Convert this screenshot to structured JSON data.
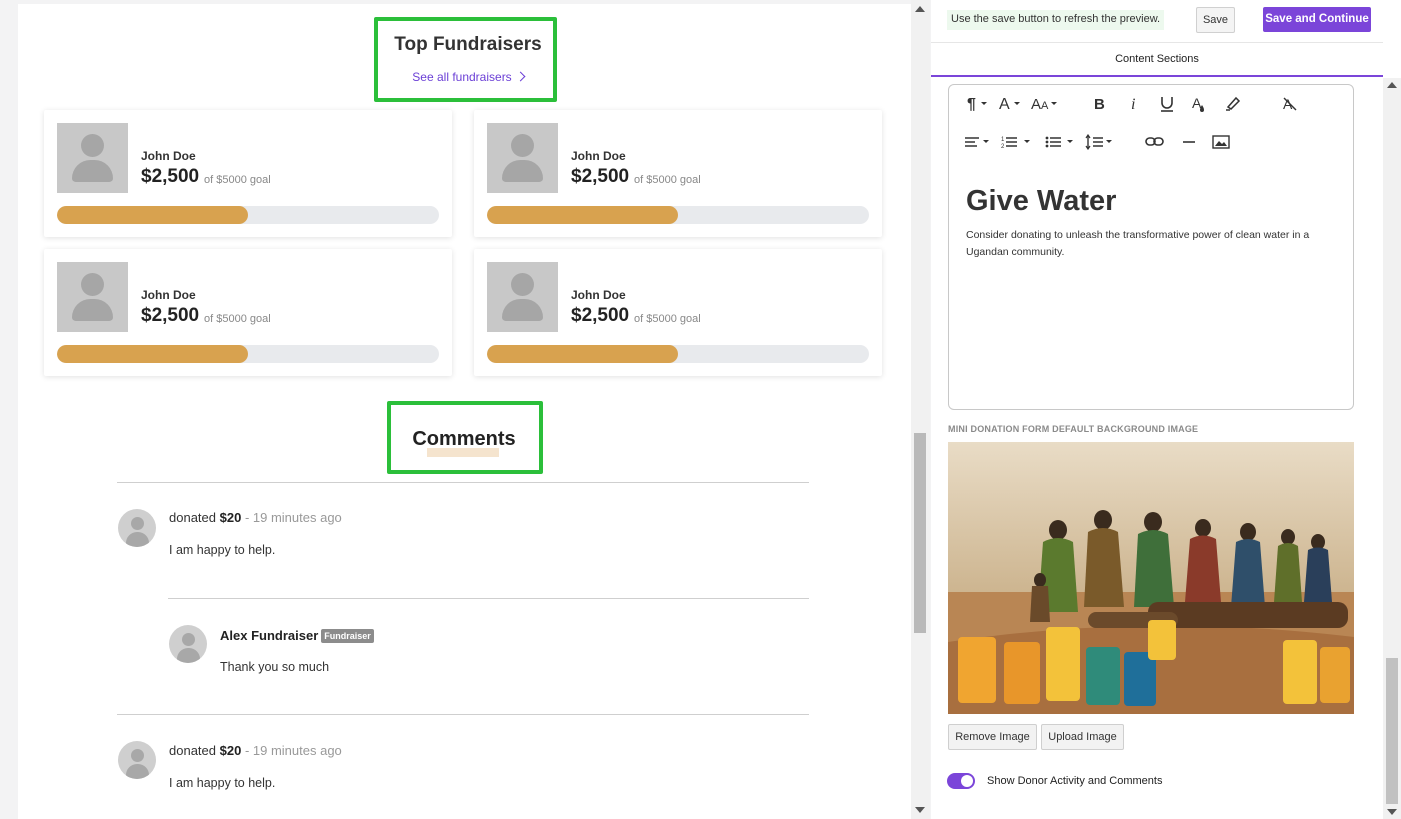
{
  "preview": {
    "top_fundraisers": {
      "title": "Top Fundraisers",
      "see_all": "See all fundraisers",
      "cards": [
        {
          "name": "John Doe",
          "amount": "$2,500",
          "goal": "of $5000 goal",
          "progress": 0.5
        },
        {
          "name": "John Doe",
          "amount": "$2,500",
          "goal": "of $5000 goal",
          "progress": 0.5
        },
        {
          "name": "John Doe",
          "amount": "$2,500",
          "goal": "of $5000 goal",
          "progress": 0.5
        },
        {
          "name": "John Doe",
          "amount": "$2,500",
          "goal": "of $5000 goal",
          "progress": 0.5
        }
      ]
    },
    "comments": {
      "title": "Comments",
      "items": [
        {
          "prefix": "donated",
          "amount": "$20",
          "time": " - 19 minutes ago",
          "text": "I am happy to help."
        },
        {
          "author": "Alex Fundraiser",
          "badge": "Fundraiser",
          "text": "Thank you so much"
        },
        {
          "prefix": "donated",
          "amount": "$20",
          "time": " - 19 minutes ago",
          "text": "I am happy to help."
        }
      ]
    }
  },
  "panel": {
    "hint": "Use the save button to refresh the preview.",
    "save": "Save",
    "save_continue": "Save and Continue",
    "tab": "Content Sections",
    "editor": {
      "heading": "Give Water",
      "body": "Consider donating to unleash the transformative power of clean water in a Ugandan community."
    },
    "image_label": "MINI DONATION FORM DEFAULT BACKGROUND IMAGE",
    "remove_image": "Remove Image",
    "upload_image": "Upload Image",
    "toggle_label": "Show Donor Activity and Comments",
    "toggle_on": true
  },
  "colors": {
    "accent": "#7b45d9",
    "progress": "#d8a24f",
    "highlight": "#2bbf3a"
  }
}
